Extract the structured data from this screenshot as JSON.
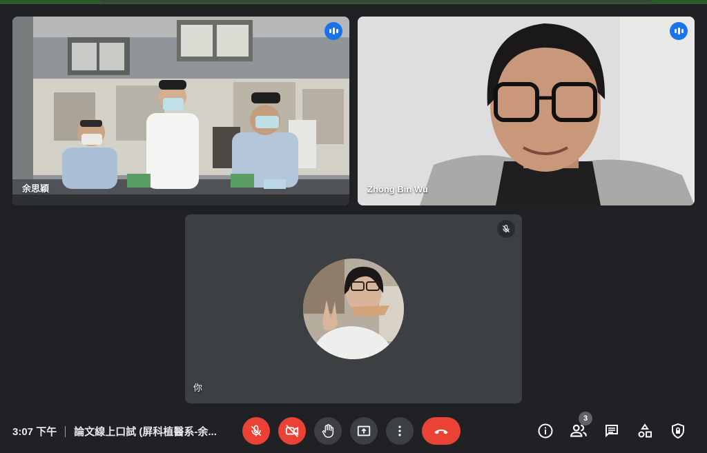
{
  "participants": [
    {
      "name": "余思穎",
      "speaking": true
    },
    {
      "name": "Zhong Bin Wu",
      "speaking": true
    },
    {
      "name": "你",
      "muted": true
    }
  ],
  "meeting": {
    "time": "3:07 下午",
    "title": "論文線上口試 (屏科植醫系-余..."
  },
  "people_count": "3",
  "colors": {
    "background": "#202124",
    "tile": "#3c4043",
    "accent_blue": "#1a73e8",
    "active_border": "#8ab4f8",
    "danger_red": "#ea4335"
  },
  "controls": {
    "mic": "mic-off-icon",
    "camera": "camera-off-icon",
    "raise_hand": "hand-icon",
    "present": "present-screen-icon",
    "more": "more-vert-icon",
    "leave": "call-end-icon"
  },
  "right_controls": [
    "info-icon",
    "people-icon",
    "chat-icon",
    "activities-icon",
    "host-controls-icon"
  ]
}
